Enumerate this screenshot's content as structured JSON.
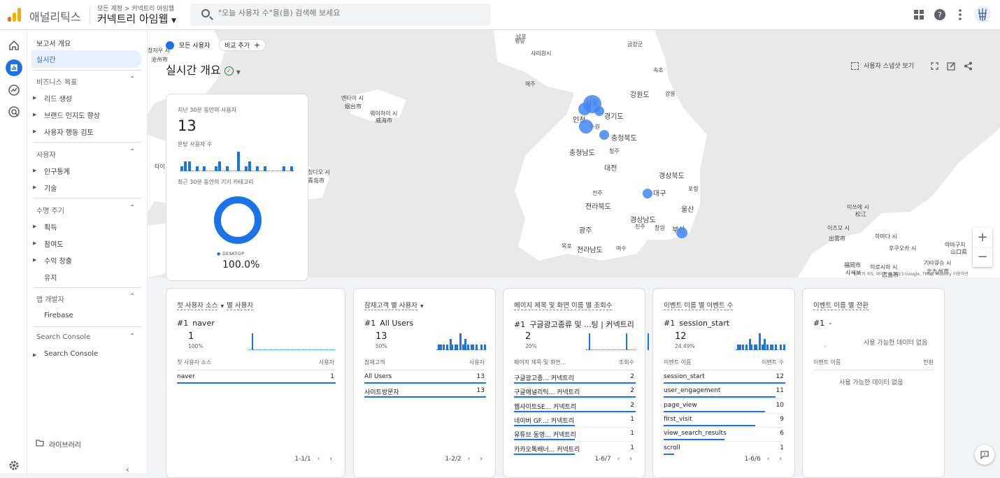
{
  "header": {
    "app_name": "애널리틱스",
    "breadcrumb_account": "모든 계정",
    "breadcrumb_sep": ">",
    "breadcrumb_property": "커넥트리 아임웹",
    "property_name": "커넥트리 아임웹",
    "search_placeholder": "\"오늘 사용자 수\"을(를) 검색해 보세요"
  },
  "nav": {
    "overview": "보고서 개요",
    "realtime": "실시간",
    "biz_goals": "비즈니스 목표",
    "lead": "리드 생성",
    "brand": "브랜드 인지도 향상",
    "behavior": "사용자 행동 검토",
    "users": "사용자",
    "demo": "인구통계",
    "tech": "기술",
    "lifecycle": "수명 주기",
    "acquisition": "획득",
    "engagement": "참여도",
    "monetization": "수익 창출",
    "retention": "유지",
    "app_dev": "앱 개발자",
    "firebase": "Firebase",
    "sc_header": "Search Console",
    "sc_item": "Search Console",
    "library": "라이브러리"
  },
  "map": {
    "all_users_chip": "모든 사용자",
    "compare_chip": "비교 추가",
    "title": "실시간 개요",
    "snapshot": "사용자 스냅샷 보기",
    "attribution": "단축키  지도 데이터 ©2023 Google, TMap Mobility  이용약관",
    "labels": [
      "평양",
      "남포",
      "사리원시",
      "해주",
      "금강군",
      "속초",
      "강원도",
      "강릉",
      "서울",
      "인천",
      "경기도",
      "수원",
      "충청북도",
      "충청남도",
      "청주",
      "대전",
      "경상북도",
      "포항",
      "대구",
      "전주",
      "전라북도",
      "울산",
      "경상남도",
      "진주",
      "창원",
      "부산",
      "광주",
      "목포",
      "전라남도",
      "여수",
      "엔타이 시",
      "烟台市",
      "웨이하이 시",
      "威海市",
      "창저우 시",
      "沧州市",
      "타이",
      "칭다오 시",
      "青岛市",
      "미쓰에 시",
      "松江",
      "이즈모 시",
      "出雲市",
      "하마다 시",
      "후쿠오카 시",
      "福岡市",
      "사세보",
      "히로시마 시",
      "広島市",
      "기타큐슈 시",
      "北九州市",
      "야마구치",
      "山口県"
    ]
  },
  "card_rt": {
    "label30": "지난 30분 동안의 사용자",
    "value": "13",
    "per_min": "분당 사용자 수",
    "device_label": "최근 30분 동안의 기기 카테고리",
    "legend": "DESKTOP",
    "percent": "100.0%"
  },
  "cards": [
    {
      "title_a": "첫 사용자 소스",
      "title_b": "별 사용자",
      "rank": "#1",
      "top": "naver",
      "value": "1",
      "pct": "100%",
      "col1": "첫 사용자 소스",
      "col2": "사용자",
      "rows": [
        [
          "naver",
          "1"
        ]
      ],
      "pager": "1-1/1"
    },
    {
      "title_a": "잠재고객 별 사용자",
      "title_b": "",
      "rank": "#1",
      "top": "All Users",
      "value": "13",
      "pct": "50%",
      "col1": "잠재고객",
      "col2": "사용자",
      "rows": [
        [
          "All Users",
          "13"
        ],
        [
          "사이트방문자",
          "13"
        ]
      ],
      "pager": "1-2/2"
    },
    {
      "title_a": "페이지 제목 및 화면 이름 별 조회수",
      "title_b": "",
      "rank": "#1",
      "top": "구글광고종류 및 ...팅 | 커넥트리",
      "value": "2",
      "pct": "20%",
      "col1": "페이지 제목 및 화면...",
      "col2": "조회수",
      "rows": [
        [
          "구글광고종... 커넥트리",
          "2"
        ],
        [
          "구글애널리틱... 커넥트리",
          "2"
        ],
        [
          "웹사이트SE... 커넥트리",
          "2"
        ],
        [
          "네이버 GF...: 커넥트리",
          "1"
        ],
        [
          "유튜브 동영... 커넥트리",
          "1"
        ],
        [
          "카카오톡배너... 커넥트리",
          "1"
        ]
      ],
      "pager": "1-6/7"
    },
    {
      "title_a": "이벤트 이름 별 이벤트 수",
      "title_b": "",
      "rank": "#1",
      "top": "session_start",
      "value": "12",
      "pct": "24.49%",
      "col1": "이벤트 이름",
      "col2": "이벤트 수",
      "rows": [
        [
          "session_start",
          "12"
        ],
        [
          "user_engagement",
          "11"
        ],
        [
          "page_view",
          "10"
        ],
        [
          "first_visit",
          "9"
        ],
        [
          "view_search_results",
          "6"
        ],
        [
          "scroll",
          "1"
        ]
      ],
      "pager": "1-6/6"
    },
    {
      "title_a": "이벤트 이름 별 전환",
      "title_b": "",
      "rank": "#1",
      "top": "-",
      "value": "",
      "pct": "-",
      "nodata": "사용 가능한 데이터 없음",
      "col1": "이벤트 이름",
      "col2": "전환",
      "rows": [],
      "pager": ""
    }
  ]
}
